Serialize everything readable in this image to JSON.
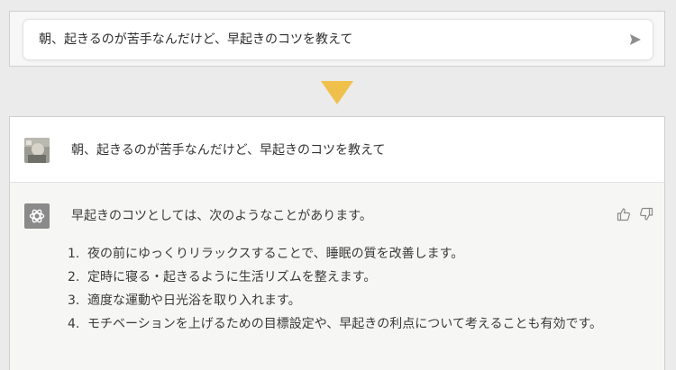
{
  "prompt_input": {
    "value": "朝、起きるのが苦手なんだけど、早起きのコツを教えて"
  },
  "conversation": {
    "user_message": "朝、起きるのが苦手なんだけど、早起きのコツを教えて",
    "assistant": {
      "intro": "早起きのコツとしては、次のようなことがあります。",
      "items": [
        {
          "num": "1.",
          "text": "夜の前にゆっくりリラックスすることで、睡眠の質を改善します。"
        },
        {
          "num": "2.",
          "text": "定時に寝る・起きるように生活リズムを整えます。"
        },
        {
          "num": "3.",
          "text": "適度な運動や日光浴を取り入れます。"
        },
        {
          "num": "4.",
          "text": "モチベーションを上げるための目標設定や、早起きの利点について考えることも有効です。"
        }
      ]
    }
  },
  "icons": {
    "send": "send-icon",
    "down_arrow": "down-arrow-icon",
    "assistant_logo": "openai-logo-icon",
    "thumbs_up": "thumbs-up-icon",
    "thumbs_down": "thumbs-down-icon"
  },
  "colors": {
    "arrow": "#f0c04a",
    "assistant_bg": "#f6f6f4",
    "avatar_bg": "#8a8a8a"
  }
}
